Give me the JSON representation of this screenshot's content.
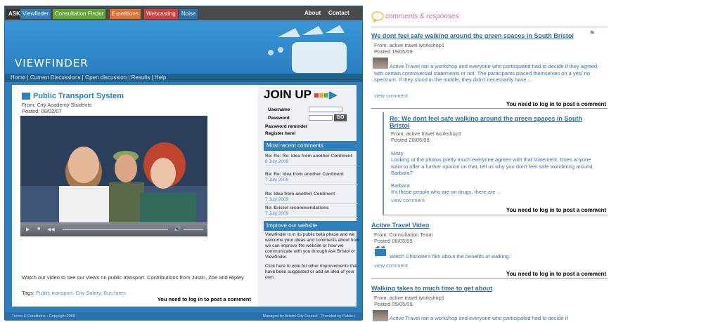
{
  "left": {
    "nav": {
      "ask": "ASK",
      "items": [
        "Viewfinder",
        "Consultation Finder",
        "E-petitions",
        "Webcasting",
        "Noise"
      ],
      "about": "About",
      "contact": "Contact"
    },
    "logo": "VIEWFINDER",
    "menu": "Home | Current Discussions | Open discussion | Results | Help",
    "video": {
      "title": "Public Transport System",
      "from": "From: City Academy Students",
      "posted": "Posted: 08/02/07",
      "description": "Watch our video to see our views on public transport. Contributions from Justin, Zoe and Ripley",
      "tags_label": "Tags:",
      "tags": "Public transport, City Safety, Bus fares",
      "login_msg": "You need to log in to post a comment"
    },
    "sidebar": {
      "join_up": "JOIN UP",
      "username_label": "Username",
      "password_label": "Password",
      "go": "GO",
      "password_reminder": "Password reminder",
      "register": "Register here!",
      "recent_heading": "Most recent comments",
      "recent": [
        {
          "title": "Re: Re: Re: Idea from another Continent",
          "date": "8 July 2009"
        },
        {
          "title": "Re: Re: Idea from another Continent",
          "date": "7 July 2009"
        },
        {
          "title": "Re: Idea from another Continent",
          "date": "7 July 2009"
        },
        {
          "title": "Re: Bristol recommendations",
          "date": "7 July 2009"
        }
      ],
      "improve_heading": "Improve our website",
      "improve_text": "Viewfinder is in its public beta phase and we welcome your ideas and comments about how we can improve the website or how we communicate with you through Ask Bristol or Viewfinder.",
      "improve_text2": "Click here to vote for other improvements that have been suggested or add an idea of your own."
    },
    "footer": {
      "left": "Terms & Conditions - Copyright 2008",
      "right": "Managed by Bristol City Council - Provided by Public-i"
    }
  },
  "right": {
    "heading": "comments & responses",
    "comments": [
      {
        "title": "We dont feel safe walking around the green spaces in South Bristol",
        "from": "From: active travel workshop1",
        "posted": "Posted 19/05/09",
        "body": "Active Travel ran a workshop and everyone who participated had to decide if they agreed with certain controversial statements or not. The participants placed themselves on a yes/ no spectrum. If they stood in the middle, they didn't necessarily have ...",
        "view": "view comment",
        "login": "You need to log in to post a comment"
      },
      {
        "title": "Re: We dont feel safe walking around the green spaces in South Bristol",
        "from": "From: active travel workshop1",
        "posted": "Posted 20/05/09",
        "body1": "Misty",
        "body2": "Looking at the photos pretty much everyone agrees with that statement. Does anyone want to offer a further opinion on that, tell us why you don't feel safe wondering around, Barbara?",
        "body3": "Barbara",
        "body4": "It's those people who are on drugs, there are ...",
        "view": "view comment",
        "login": "You need to log in to post a comment"
      },
      {
        "title": "Active Travel Video",
        "from": "From: Consultation Team",
        "posted": "Posted 08/05/09",
        "body": "Watch Charlotte's film about the benefits of walking.",
        "view": "view comment",
        "login": "You need to log in to post a comment"
      },
      {
        "title": "Walking takes to much time to get about",
        "from": "From: active travel workshop1",
        "posted": "Posted 05/05/09",
        "body": "Active Travel ran a workshop and everyone who participated had to decide if"
      }
    ]
  }
}
